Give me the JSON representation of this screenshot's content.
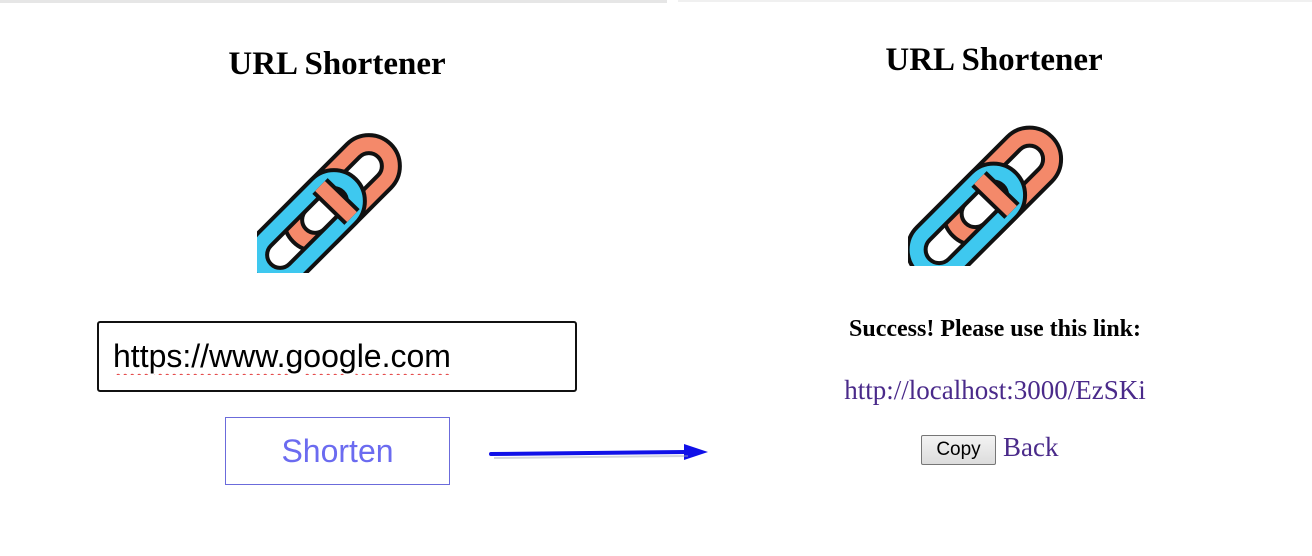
{
  "before": {
    "title": "URL Shortener",
    "input": {
      "value": "https://www.google.com",
      "placeholder": ""
    },
    "shorten_label": "Shorten"
  },
  "after": {
    "title": "URL Shortener",
    "success_message": "Success! Please use this link:",
    "short_url": "http://localhost:3000/EzSKi",
    "copy_label": "Copy",
    "back_label": "Back"
  },
  "colors": {
    "chain_link_blue": "#3ec8ef",
    "chain_link_orange": "#f4896a",
    "shorten_text": "#6b6bf0",
    "link": "#4a2a8a",
    "arrow": "#1010e8"
  },
  "icons": {
    "logo": "chain-link-icon",
    "flow_arrow": "arrow-right-icon"
  }
}
